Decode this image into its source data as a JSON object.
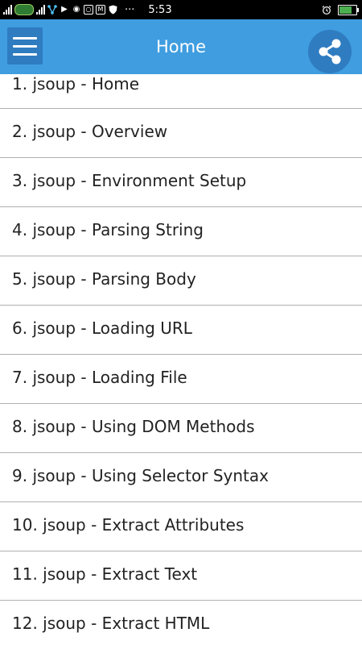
{
  "status_bar": {
    "time": "5:53",
    "more_indicator": "···",
    "icons": [
      "signal-icon",
      "carrier-logo",
      "signal-icon",
      "network-share-icon",
      "gmail-icon",
      "location-icon",
      "instagram-icon",
      "mail-icon",
      "shield-icon",
      "alarm-icon",
      "battery-icon"
    ],
    "battery_level": 0.7,
    "battery_color": "#4caf50"
  },
  "app_bar": {
    "title": "Home",
    "background": "#3f9de0",
    "button_background": "#2f7cc0",
    "menu_icon": "hamburger-menu-icon",
    "share_icon": "share-icon"
  },
  "topics": [
    {
      "label": "1. jsoup - Home"
    },
    {
      "label": "2. jsoup - Overview"
    },
    {
      "label": "3. jsoup - Environment Setup"
    },
    {
      "label": "4. jsoup - Parsing String"
    },
    {
      "label": "5. jsoup - Parsing Body"
    },
    {
      "label": "6. jsoup - Loading URL"
    },
    {
      "label": "7. jsoup - Loading File"
    },
    {
      "label": "8. jsoup - Using DOM Methods"
    },
    {
      "label": "9. jsoup - Using Selector Syntax"
    },
    {
      "label": "10. jsoup - Extract Attributes"
    },
    {
      "label": "11. jsoup - Extract Text"
    },
    {
      "label": "12. jsoup - Extract HTML"
    }
  ]
}
